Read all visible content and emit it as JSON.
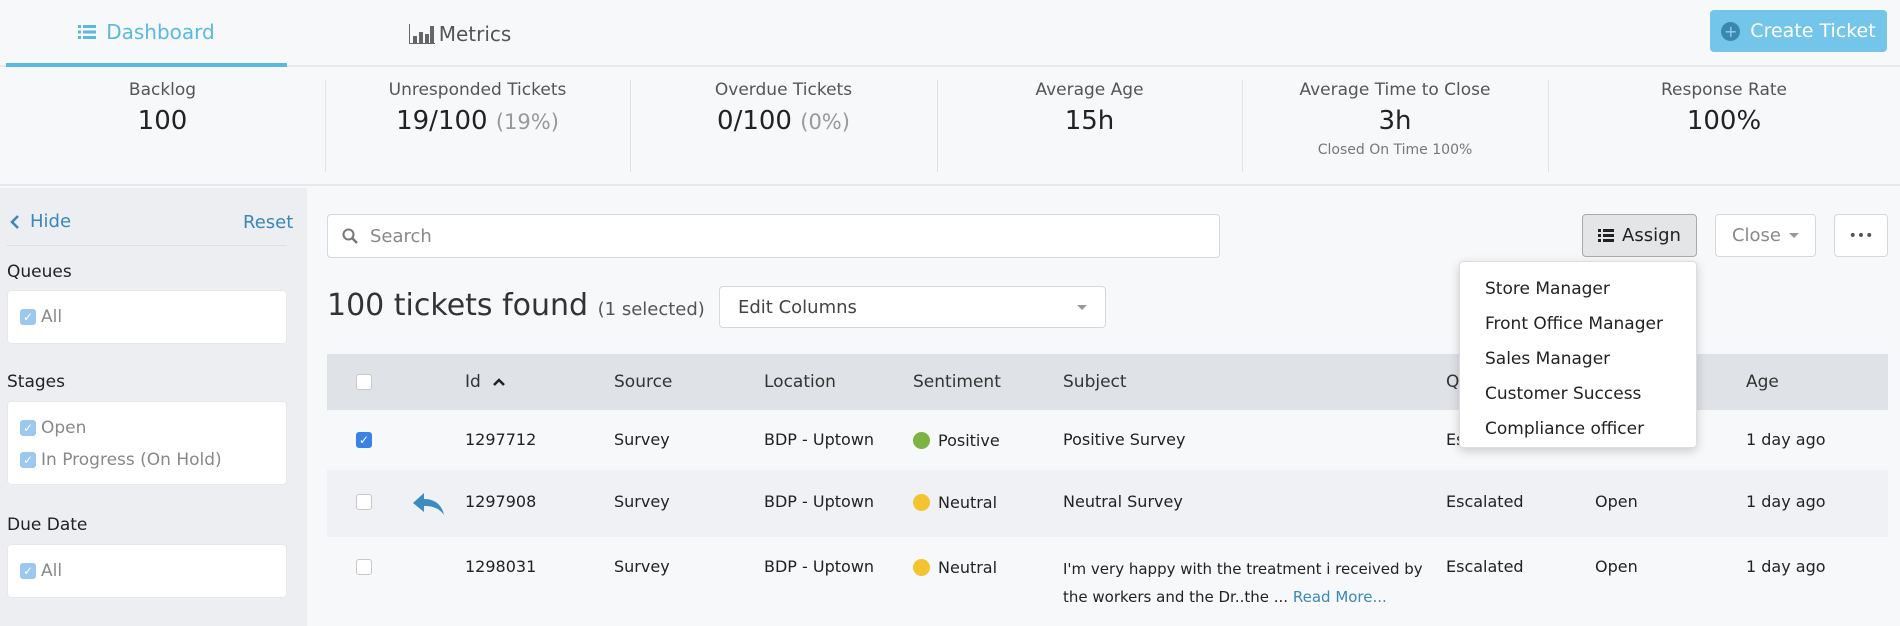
{
  "tabs": [
    {
      "label": "Dashboard",
      "icon": "list-icon",
      "active": true
    },
    {
      "label": "Metrics",
      "icon": "bar-chart-icon",
      "active": false
    }
  ],
  "create_ticket": "Create Ticket",
  "stats": [
    {
      "label": "Backlog",
      "value": "100"
    },
    {
      "label": "Unresponded Tickets",
      "value": "19/100",
      "pct": "(19%)"
    },
    {
      "label": "Overdue Tickets",
      "value": "0/100",
      "pct": "(0%)"
    },
    {
      "label": "Average Age",
      "value": "15h"
    },
    {
      "label": "Average Time to Close",
      "value": "3h",
      "sub": "Closed On Time 100%"
    },
    {
      "label": "Response Rate",
      "value": "100%"
    }
  ],
  "sidebar": {
    "hide": "Hide",
    "reset": "Reset",
    "queues": {
      "title": "Queues",
      "items": [
        "All"
      ]
    },
    "stages": {
      "title": "Stages",
      "items": [
        "Open",
        "In Progress (On Hold)"
      ]
    },
    "due": {
      "title": "Due Date",
      "items": [
        "All"
      ]
    }
  },
  "search": {
    "placeholder": "Search",
    "value": ""
  },
  "toolbar": {
    "assign": "Assign",
    "close": "Close",
    "more": "•••"
  },
  "assign_menu": [
    "Store Manager",
    "Front Office Manager",
    "Sales Manager",
    "Customer Success",
    "Compliance officer"
  ],
  "results": {
    "count": "100 tickets found",
    "selected": "(1 selected)",
    "edit_columns": "Edit Columns"
  },
  "columns": {
    "id": "Id",
    "source": "Source",
    "location": "Location",
    "sentiment": "Sentiment",
    "subject": "Subject",
    "queue": "Queue",
    "age": "Age"
  },
  "colors": {
    "positive": "#7cb342",
    "neutral": "#f4c430",
    "accent": "#5bb8e0",
    "link": "#3a87b8"
  },
  "rows": [
    {
      "checked": true,
      "id": "1297712",
      "source": "Survey",
      "location": "BDP - Uptown",
      "sentiment": "Positive",
      "subject": "Positive Survey",
      "queue": "Escalated",
      "age": "1 day ago"
    },
    {
      "checked": false,
      "replied": true,
      "id": "1297908",
      "source": "Survey",
      "location": "BDP - Uptown",
      "sentiment": "Neutral",
      "subject": "Neutral Survey",
      "queue": "Escalated",
      "stage": "Open",
      "age": "1 day ago"
    },
    {
      "checked": false,
      "id": "1298031",
      "source": "Survey",
      "location": "BDP - Uptown",
      "sentiment": "Neutral",
      "subject": "I'm very happy with the treatment i received by the workers and the Dr..the ...",
      "read_more": "Read More...",
      "queue": "Escalated",
      "stage": "Open",
      "age": "1 day ago"
    }
  ]
}
